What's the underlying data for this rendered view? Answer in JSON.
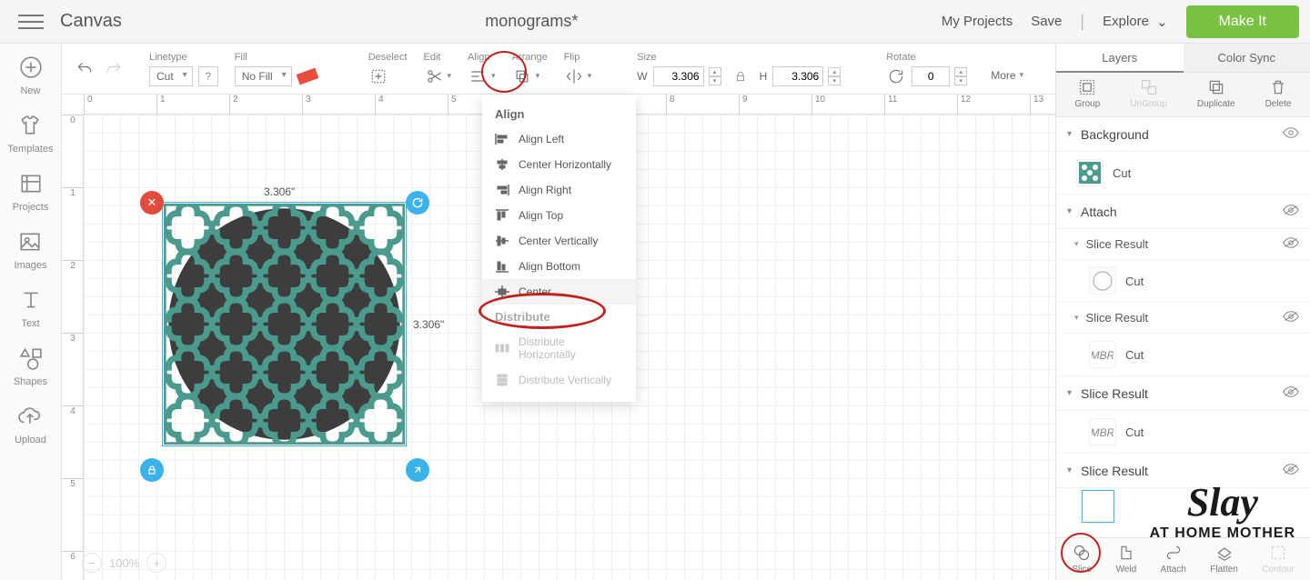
{
  "header": {
    "app_title": "Canvas",
    "doc_title": "monograms*",
    "my_projects": "My Projects",
    "save": "Save",
    "explore": "Explore",
    "make_it": "Make It"
  },
  "leftrail": [
    {
      "name": "new",
      "label": "New"
    },
    {
      "name": "templates",
      "label": "Templates"
    },
    {
      "name": "projects",
      "label": "Projects"
    },
    {
      "name": "images",
      "label": "Images"
    },
    {
      "name": "text",
      "label": "Text"
    },
    {
      "name": "shapes",
      "label": "Shapes"
    },
    {
      "name": "upload",
      "label": "Upload"
    }
  ],
  "toolbar": {
    "linetype_label": "Linetype",
    "linetype_value": "Cut",
    "fill_label": "Fill",
    "fill_value": "No Fill",
    "deselect": "Deselect",
    "edit": "Edit",
    "align": "Align",
    "arrange": "Arrange",
    "flip": "Flip",
    "size": "Size",
    "w_label": "W",
    "w_value": "3.306",
    "h_label": "H",
    "h_value": "3.306",
    "rotate": "Rotate",
    "rotate_value": "0",
    "more": "More"
  },
  "align_panel": {
    "section1": "Align",
    "items1": [
      "Align Left",
      "Center Horizontally",
      "Align Right",
      "Align Top",
      "Center Vertically",
      "Align Bottom",
      "Center"
    ],
    "section2": "Distribute",
    "items2": [
      "Distribute Horizontally",
      "Distribute Vertically"
    ]
  },
  "canvas": {
    "dim_w_label": "3.306\"",
    "dim_h_label": "3.306\"",
    "ruler_h_ticks": [
      "0",
      "1",
      "2",
      "3",
      "4",
      "5",
      "6",
      "7",
      "8",
      "9",
      "10",
      "11",
      "12",
      "13"
    ],
    "ruler_v_ticks": [
      "0",
      "1",
      "2",
      "3",
      "4",
      "5",
      "6"
    ],
    "zoom": "100%"
  },
  "rightpanel": {
    "tabs": [
      "Layers",
      "Color Sync"
    ],
    "actions": [
      "Group",
      "UnGroup",
      "Duplicate",
      "Delete"
    ],
    "layers": [
      {
        "group": "Background",
        "eye": "on",
        "items": [
          {
            "thumb": "pattern",
            "label": "Cut"
          }
        ]
      },
      {
        "group": "Attach",
        "eye": "off",
        "items": [
          {
            "sub": "Slice Result",
            "thumb": "circle",
            "label": "Cut",
            "eye": "off"
          },
          {
            "sub": "Slice Result",
            "thumb": "mono",
            "label": "Cut",
            "eye": "off"
          }
        ]
      },
      {
        "group": "Slice Result",
        "eye": "off",
        "items": [
          {
            "thumb": "mono",
            "label": "Cut"
          }
        ]
      },
      {
        "group": "Slice Result",
        "eye": "off",
        "items": []
      }
    ],
    "bottom": [
      "Slice",
      "Weld",
      "Attach",
      "Flatten",
      "Contour"
    ]
  },
  "watermark": {
    "line1": "Slay",
    "line2": "AT HOME MOTHER"
  }
}
